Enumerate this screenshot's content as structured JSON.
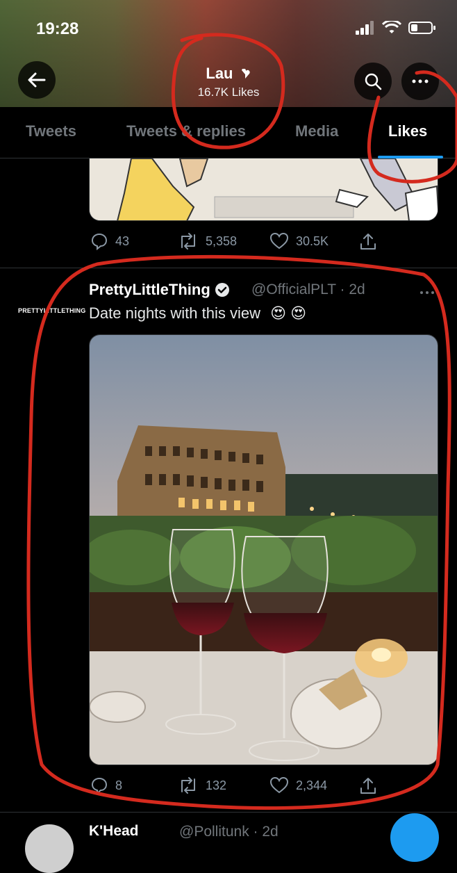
{
  "status_bar": {
    "time": "19:28"
  },
  "header": {
    "name": "Lau",
    "likes_count": "16.7K Likes"
  },
  "tabs": [
    {
      "label": "Tweets",
      "active": false
    },
    {
      "label": "Tweets & replies",
      "active": false
    },
    {
      "label": "Media",
      "active": false
    },
    {
      "label": "Likes",
      "active": true
    }
  ],
  "previous_tweet": {
    "replies": "43",
    "retweets": "5,358",
    "likes": "30.5K"
  },
  "tweet": {
    "avatar_text": "PRETTYLITTLETHING",
    "display_name": "PrettyLittleThing",
    "handle_time": "@OfficialPLT · 2d",
    "text": "Date nights with this view",
    "emoji": "😍 😍",
    "replies": "8",
    "retweets": "132",
    "likes": "2,344"
  },
  "next_tweet": {
    "display_name": "K'Head",
    "handle_time": "@Pollitunk · 2d"
  },
  "colors": {
    "accent": "#1d9bf0",
    "background": "#000000",
    "annotation": "#d42a1e"
  }
}
